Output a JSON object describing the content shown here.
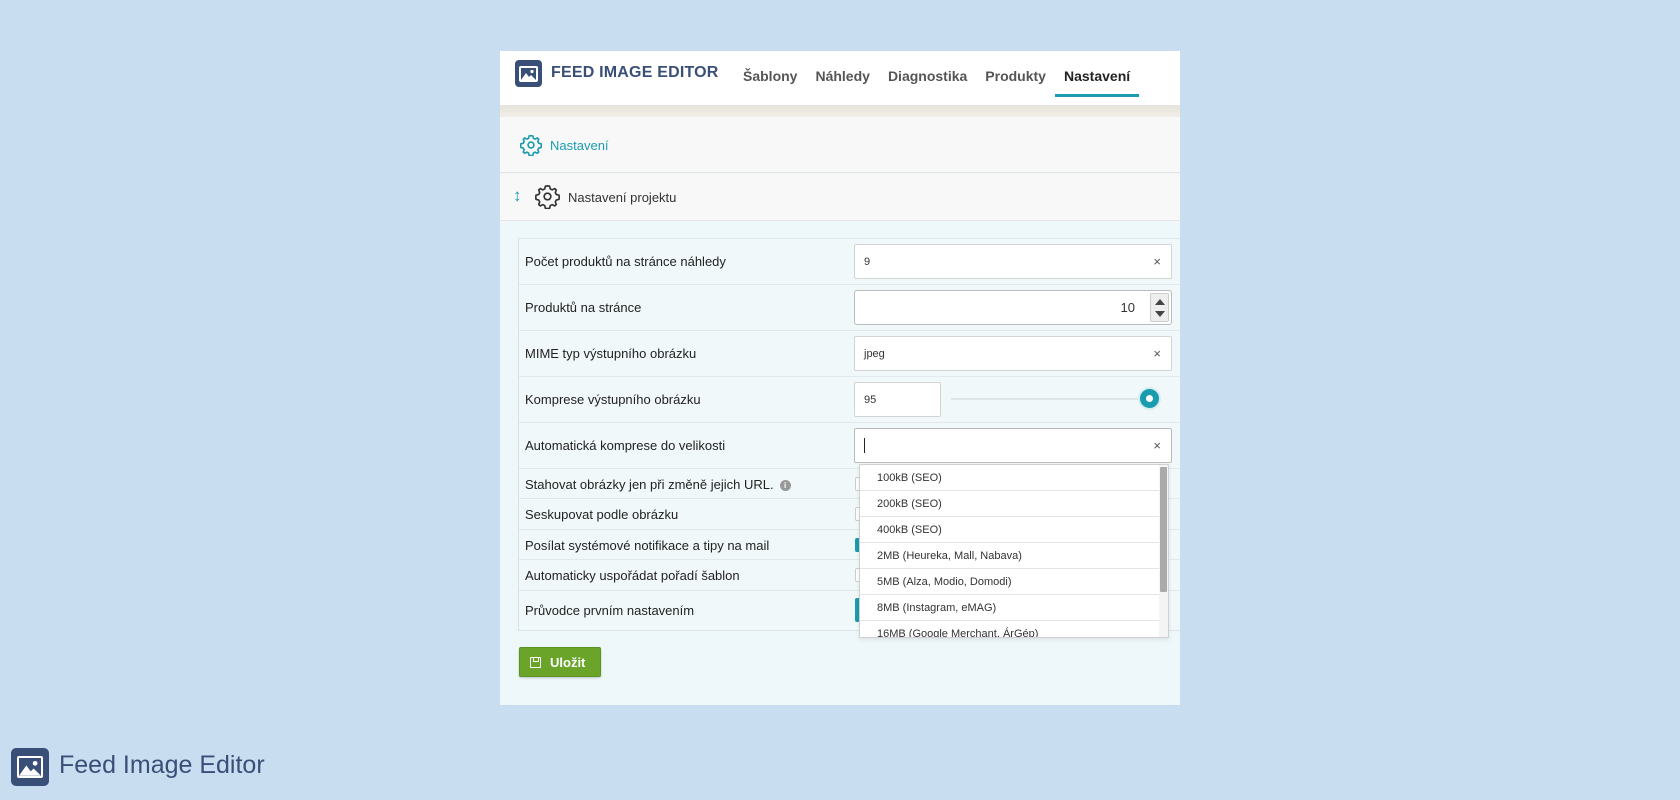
{
  "header": {
    "brand": "FEED IMAGE EDITOR",
    "nav": [
      "Šablony",
      "Náhledy",
      "Diagnostika",
      "Produkty",
      "Nastavení"
    ],
    "active_nav": "Nastavení"
  },
  "page_title": "Nastavení",
  "section_title": "Nastavení projektu",
  "fields": {
    "products_per_preview": {
      "label": "Počet produktů na stránce náhledy",
      "value": "9"
    },
    "products_per_page": {
      "label": "Produktů na stránce",
      "value": "10"
    },
    "mime_type": {
      "label": "MIME typ výstupního obrázku",
      "value": "jpeg"
    },
    "compression": {
      "label": "Komprese výstupního obrázku",
      "value": "95",
      "slider_level": 0.95
    },
    "auto_compression": {
      "label": "Automatická komprese do velikosti",
      "value": ""
    },
    "download_on_url_change": {
      "label": "Stahovat obrázky jen při změně jejich URL.",
      "checked": false
    },
    "group_by_image": {
      "label": "Seskupovat podle obrázku",
      "checked": false
    },
    "send_notifications": {
      "label": "Posílat systémové notifikace a tipy na mail",
      "checked": true
    },
    "auto_sort_templates": {
      "label": "Automaticky uspořádat pořadí šablon",
      "checked": false
    },
    "first_setup_wizard": {
      "label": "Průvodce prvním nastavením"
    }
  },
  "dropdown_options": [
    "100kB (SEO)",
    "200kB (SEO)",
    "400kB (SEO)",
    "2MB (Heureka, Mall, Nabava)",
    "5MB (Alza, Modio, Domodi)",
    "8MB (Instagram, eMAG)",
    "16MB (Google Merchant, ÁrGép)"
  ],
  "save_label": "Uložit",
  "footer_brand": "Feed Image Editor",
  "colors": {
    "accent": "#1a9cb0",
    "brand": "#3a4f78",
    "save": "#6aa52a",
    "background": "#c8def0"
  },
  "icons": [
    "image-logo-icon",
    "gear-icon",
    "sort-icon",
    "info-icon",
    "save-icon",
    "clear-icon"
  ]
}
